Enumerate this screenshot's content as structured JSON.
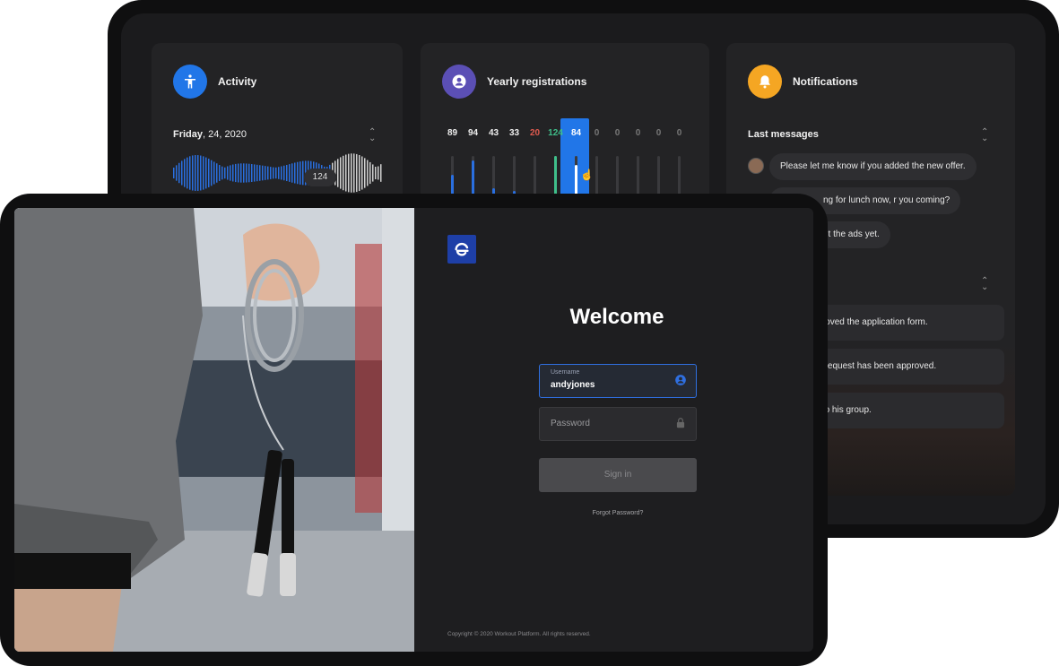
{
  "dashboard": {
    "activity": {
      "title": "Activity",
      "date_day": "Friday",
      "date_rest": ", 24, 2020",
      "bubble_value": "124",
      "icon": "accessibility-icon",
      "color": "#2176e8"
    },
    "yearly": {
      "title": "Yearly registrations",
      "icon": "user-icon",
      "color": "#5b4fb5",
      "values": [
        "89",
        "94",
        "43",
        "33",
        "20",
        "124",
        "84",
        "0",
        "0",
        "0",
        "0",
        "0"
      ],
      "value_colors": [
        "#eeeeee",
        "#eeeeee",
        "#eeeeee",
        "#eeeeee",
        "#e05a4f",
        "#3fbf8a",
        "#ffffff",
        "#777777",
        "#777777",
        "#777777",
        "#777777",
        "#777777"
      ],
      "bar_levels": [
        0.6,
        0.9,
        0.3,
        0.25,
        0.15,
        1.0,
        0.8,
        0,
        0,
        0,
        0,
        0
      ],
      "bar_colors": [
        "#2a6fe0",
        "#2a6fe0",
        "#2a6fe0",
        "#2a6fe0",
        "#2a6fe0",
        "#3fbf8a",
        "#ffffff",
        "#555555",
        "#555555",
        "#555555",
        "#555555",
        "#555555"
      ]
    },
    "notifications": {
      "title": "Notifications",
      "icon": "bell-icon",
      "color": "#f5a623",
      "last_messages_label": "Last messages",
      "messages": [
        "Please let me know if you added the new offer.",
        "ng for lunch now, r you coming?",
        "nt the ads yet."
      ],
      "items": [
        "ole approved the application form.",
        "change request has been approved.",
        "ed you to his group."
      ]
    }
  },
  "login": {
    "welcome": "Welcome",
    "username_label": "Username",
    "username_value": "andyjones",
    "password_placeholder": "Password",
    "signin_label": "Sign in",
    "forgot_label": "Forgot Password?",
    "copyright": "Copyright © 2020 Workout Platform. All rights reserved.",
    "accent": "#2f6fe0"
  }
}
